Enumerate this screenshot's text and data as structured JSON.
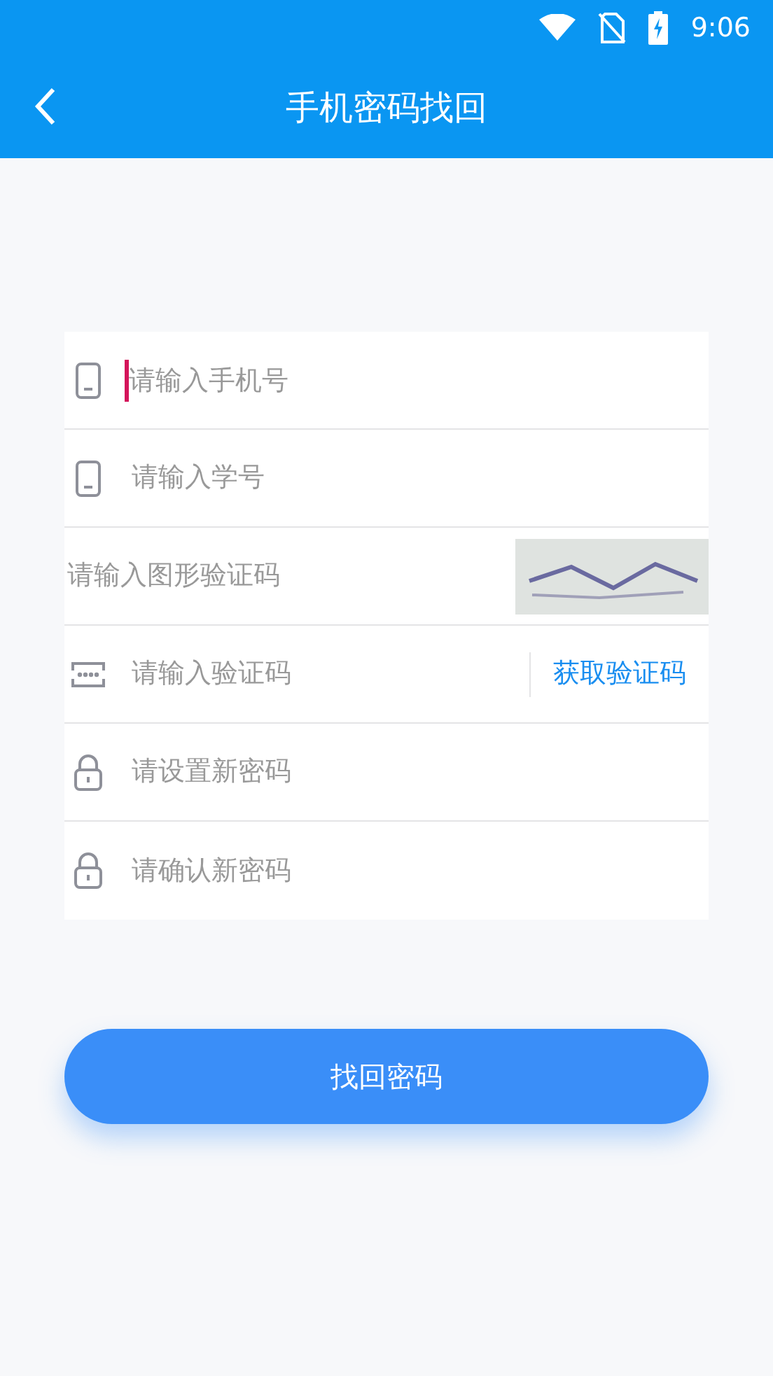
{
  "status_bar": {
    "time": "9:06"
  },
  "header": {
    "title": "手机密码找回"
  },
  "fields": [
    {
      "kind": "phone",
      "placeholder": "请输入手机号",
      "focused": true
    },
    {
      "kind": "phone",
      "placeholder": "请输入学号",
      "focused": false
    },
    {
      "kind": "captcha",
      "placeholder": "请输入图形验证码",
      "focused": false
    },
    {
      "kind": "code",
      "placeholder": "请输入验证码",
      "focused": false,
      "action": "获取验证码"
    },
    {
      "kind": "lock",
      "placeholder": "请设置新密码",
      "focused": false
    },
    {
      "kind": "lock",
      "placeholder": "请确认新密码",
      "focused": false
    }
  ],
  "submit": "找回密码"
}
